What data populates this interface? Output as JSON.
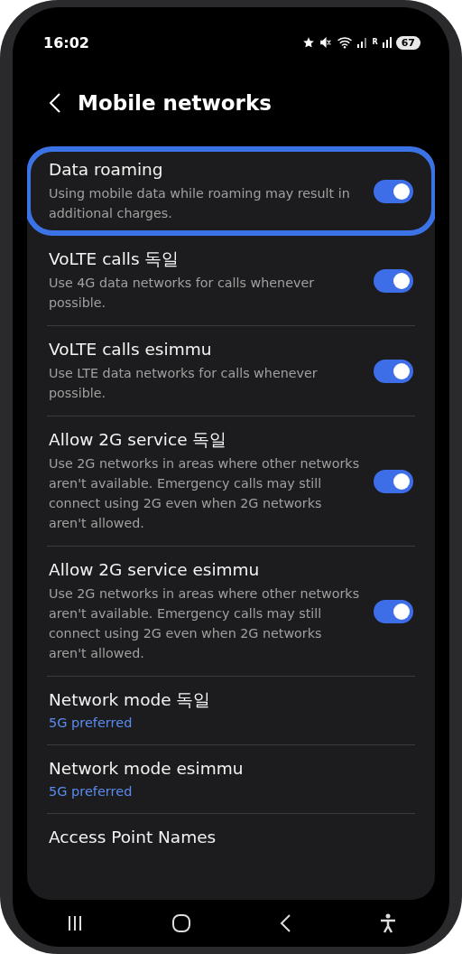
{
  "status_bar": {
    "time": "16:02",
    "roaming_mark": "R",
    "battery": "67"
  },
  "header": {
    "title": "Mobile networks"
  },
  "items": [
    {
      "kind": "toggle",
      "title": "Data roaming",
      "subtitle": "Using mobile data while roaming may result in additional charges.",
      "on": true,
      "selected": true
    },
    {
      "kind": "toggle",
      "title": "VoLTE calls 독일",
      "subtitle": "Use 4G data networks for calls whenever possible.",
      "on": true,
      "selected": false
    },
    {
      "kind": "toggle",
      "title": "VoLTE calls esimmu",
      "subtitle": "Use LTE data networks for calls whenever possible.",
      "on": true,
      "selected": false
    },
    {
      "kind": "toggle",
      "title": "Allow 2G service 독일",
      "subtitle": "Use 2G networks in areas where other networks aren't available. Emergency calls may still connect using 2G even when 2G networks aren't allowed.",
      "on": true,
      "selected": false
    },
    {
      "kind": "toggle",
      "title": "Allow 2G service esimmu",
      "subtitle": "Use 2G networks in areas where other networks aren't available. Emergency calls may still connect using 2G even when 2G networks aren't allowed.",
      "on": true,
      "selected": false
    },
    {
      "kind": "value",
      "title": "Network mode 독일",
      "value": "5G preferred",
      "selected": false
    },
    {
      "kind": "value",
      "title": "Network mode esimmu",
      "value": "5G preferred",
      "selected": false
    },
    {
      "kind": "link",
      "title": "Access Point Names",
      "selected": false
    }
  ]
}
